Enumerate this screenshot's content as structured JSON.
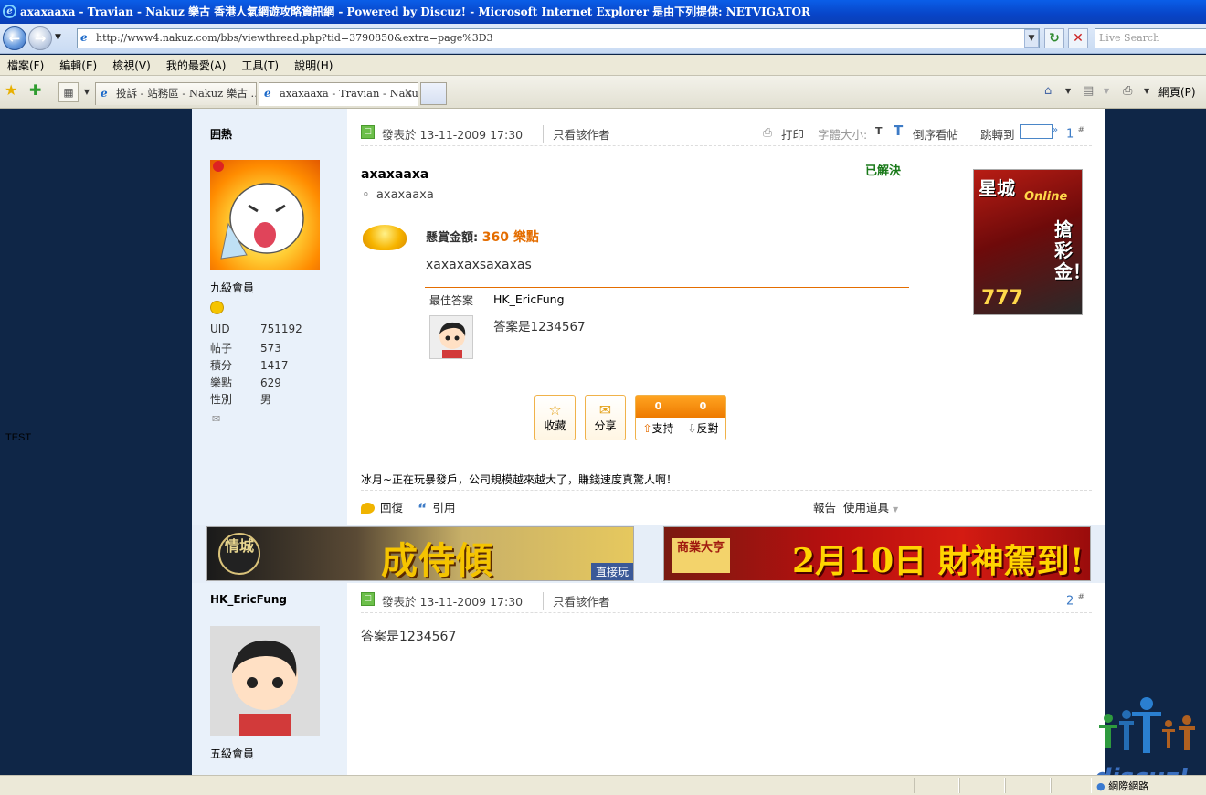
{
  "window": {
    "title": "axaxaaxa - Travian - Nakuz 樂古 香港人氣網遊攻略資訊網 - Powered by Discuz! - Microsoft Internet Explorer 是由下列提供: NETVIGATOR"
  },
  "address_bar": {
    "url": "http://www4.nakuz.com/bbs/viewthread.php?tid=3790850&extra=page%3D3",
    "search_placeholder": "Live Search"
  },
  "menu": [
    "檔案(F)",
    "編輯(E)",
    "檢視(V)",
    "我的最愛(A)",
    "工具(T)",
    "說明(H)"
  ],
  "tabs": [
    {
      "label": "投訴 - 站務區 - Nakuz 樂古 ..."
    },
    {
      "label": "axaxaaxa - Travian - Naku..."
    }
  ],
  "toolbar_right": {
    "page_label": "網頁(P)"
  },
  "page": {
    "side_label": "TEST",
    "posts": [
      {
        "author": {
          "name": "囲熱",
          "rank": "九級會員",
          "stats": [
            {
              "k": "UID",
              "v": "751192"
            },
            {
              "k": "帖子",
              "v": "573"
            },
            {
              "k": "積分",
              "v": "1417"
            },
            {
              "k": "樂點",
              "v": "629"
            },
            {
              "k": "性別",
              "v": "男"
            }
          ]
        },
        "posted_at": "發表於 13-11-2009 17:30",
        "author_only": "只看該作者",
        "print": "打印",
        "font_size_label": "字體大小:",
        "font_small": "T",
        "font_big": "T",
        "reverse": "倒序看帖",
        "jump_to": "跳轉到",
        "floor": "1",
        "floor_mark": "#",
        "solved": "已解決",
        "title": "axaxaaxa",
        "tag": "axaxaaxa",
        "bounty_label": "懸賞金額:",
        "bounty_amount": "360 樂點",
        "body": "xaxaxaxsaxaxas",
        "best_answer_label": "最佳答案",
        "best_answer_user": "HK_EricFung",
        "best_answer_text": "答案是1234567",
        "actions": {
          "favorite": "收藏",
          "share": "分享",
          "support_count": "0",
          "oppose_count": "0",
          "support": "支持",
          "oppose": "反對"
        },
        "signature": "冰月~正在玩暴發戶，公司規模越來越大了，賺錢速度真驚人啊！",
        "reply": "回復",
        "quote": "引用",
        "report": "報告",
        "use_tools": "使用道具"
      },
      {
        "author": {
          "name": "HK_EricFung",
          "rank": "五級會員"
        },
        "posted_at": "發表於 13-11-2009 17:30",
        "author_only": "只看該作者",
        "floor": "2",
        "floor_mark": "#",
        "body": "答案是1234567"
      }
    ],
    "ads": {
      "side_ad": {
        "line1": "星城",
        "online": "Online",
        "line2": "搶彩金！",
        "line3": "777"
      },
      "banner_left": {
        "logo": "情城",
        "text": "成侍傾",
        "fb": "直接玩"
      },
      "banner_right": {
        "logo": "商業大亨",
        "text": "2月10日 財神駕到!"
      }
    },
    "watermark": "discuz!"
  },
  "statusbar": {
    "zone": "網際網路"
  }
}
